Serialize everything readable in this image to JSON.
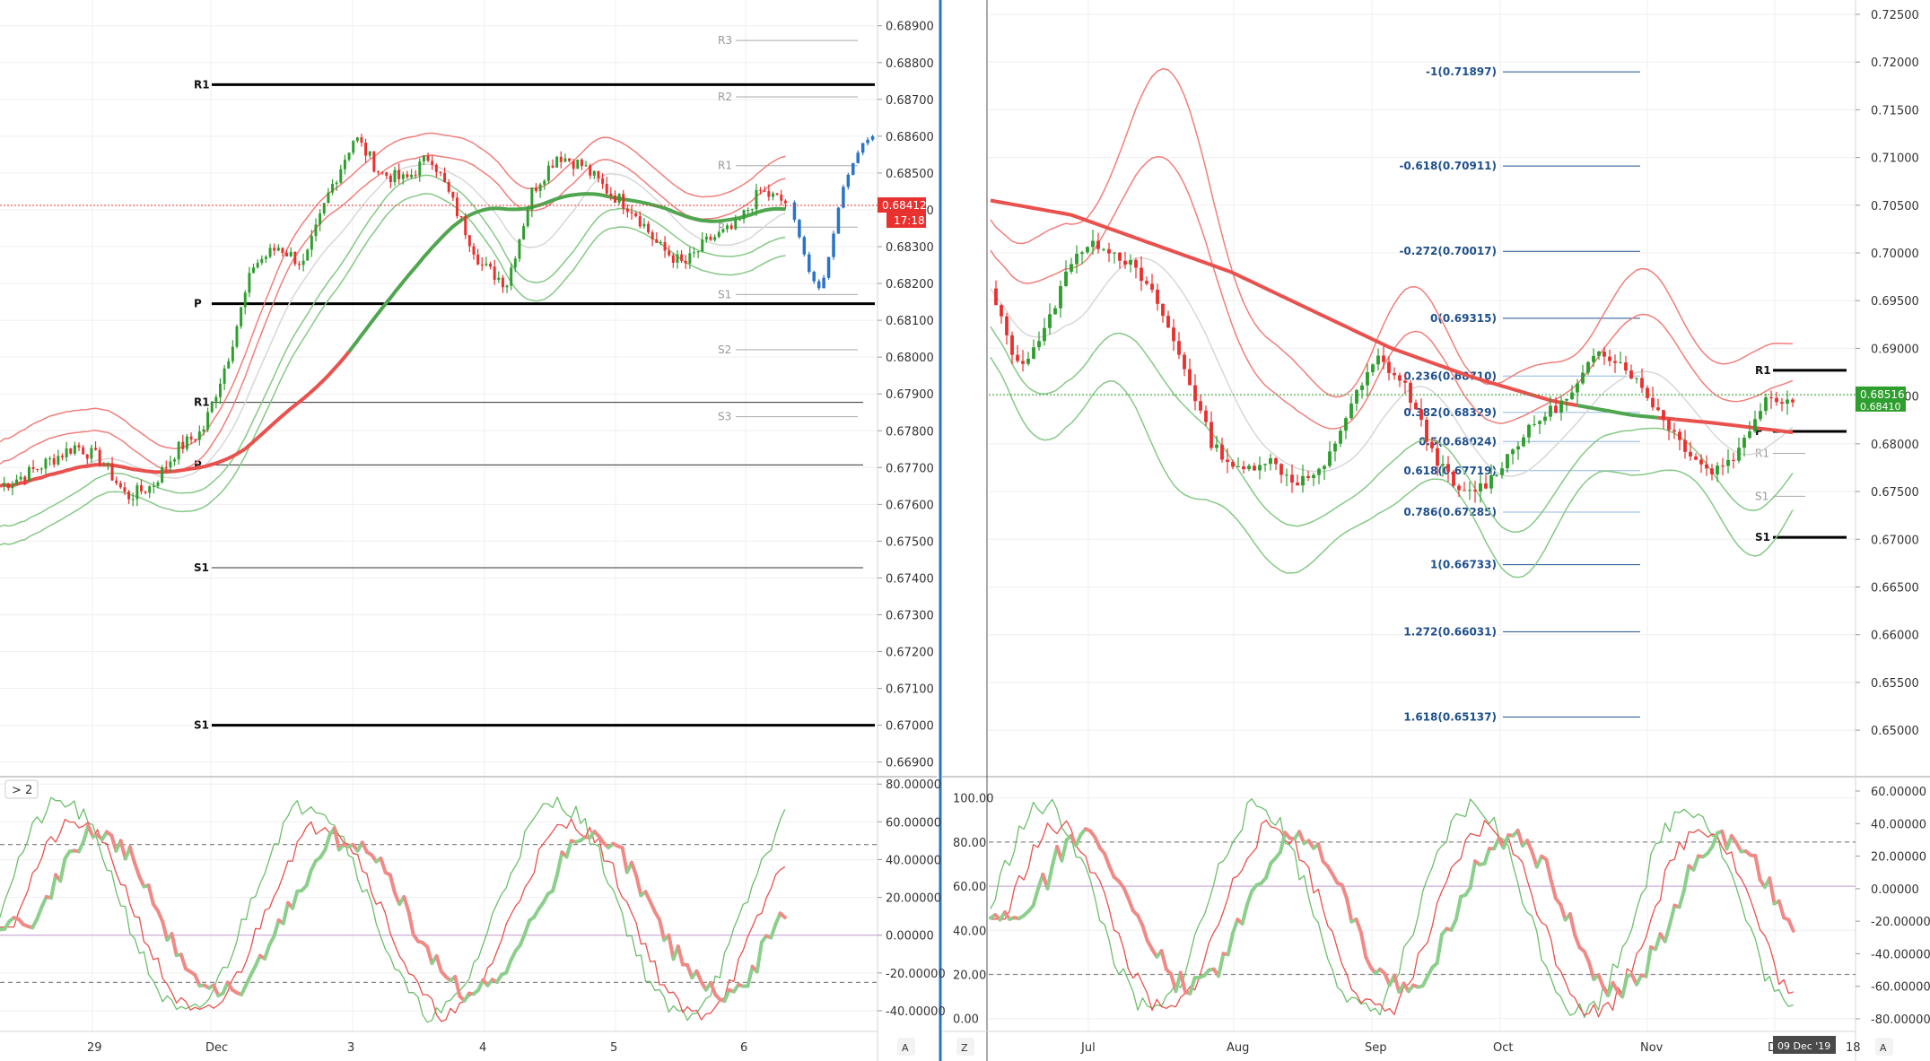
{
  "colors": {
    "bull": "#2e9e2e",
    "bear": "#e8312f",
    "forecast": "#2a73c9",
    "band_red": "#f07f7b",
    "band_green": "#86c986",
    "ma_red": "#e8514d",
    "ma_green": "#4fa64f",
    "grid": "#efefef",
    "divider": "#2a73c9",
    "price_tag": "#e8312f",
    "price_tag2": "#2e9e2e",
    "fib_line": "#1e4f8c"
  },
  "toolbar": {
    "collapse_label": "> 2"
  },
  "corner_buttons": {
    "auto_label": "A",
    "zoom_label": "Z",
    "auto_label_right": "A"
  },
  "chart_data": [
    {
      "id": "left-price",
      "type": "candlestick",
      "y_ticks": [
        "0.68900",
        "0.68800",
        "0.68700",
        "0.68600",
        "0.68500",
        "0.68400",
        "0.68300",
        "0.68200",
        "0.68100",
        "0.68000",
        "0.67900",
        "0.67800",
        "0.67700",
        "0.67600",
        "0.67500",
        "0.67400",
        "0.67300",
        "0.67200",
        "0.67100",
        "0.67000",
        "0.66900"
      ],
      "ylim": [
        0.6687,
        0.6897
      ],
      "x_ticks": [
        "29",
        "Dec",
        "3",
        "4",
        "5",
        "6"
      ],
      "current_price": {
        "value": 0.68412,
        "label": "0.68412",
        "countdown": "17:18"
      },
      "pivot_levels": [
        {
          "label": "R1",
          "value": 0.6874,
          "style": "bold"
        },
        {
          "label": "P",
          "value": 0.68145,
          "style": "bold"
        },
        {
          "label": "S1",
          "value": 0.67,
          "style": "bold"
        },
        {
          "label": "R1",
          "value": 0.67877,
          "style": "thin"
        },
        {
          "label": "P",
          "value": 0.67707,
          "style": "thin"
        },
        {
          "label": "S1",
          "value": 0.67428,
          "style": "thin"
        },
        {
          "label": "R3",
          "value": 0.6886,
          "style": "grey"
        },
        {
          "label": "R2",
          "value": 0.68707,
          "style": "grey"
        },
        {
          "label": "R1",
          "value": 0.6852,
          "style": "grey"
        },
        {
          "label": "P",
          "value": 0.68353,
          "style": "grey"
        },
        {
          "label": "S1",
          "value": 0.6817,
          "style": "grey"
        },
        {
          "label": "S2",
          "value": 0.6802,
          "style": "grey"
        },
        {
          "label": "S3",
          "value": 0.67838,
          "style": "grey"
        }
      ]
    },
    {
      "id": "right-price",
      "type": "candlestick",
      "y_ticks": [
        "0.72500",
        "0.72000",
        "0.71500",
        "0.71000",
        "0.70500",
        "0.70000",
        "0.69500",
        "0.69000",
        "0.68500",
        "0.68000",
        "0.67500",
        "0.67000",
        "0.66500",
        "0.66000",
        "0.65500",
        "0.65000"
      ],
      "ylim": [
        0.6455,
        0.7265
      ],
      "x_ticks": [
        "Jul",
        "Aug",
        "Sep",
        "Oct",
        "Nov",
        "D",
        "18"
      ],
      "current_price": {
        "value": 0.68516,
        "label": "0.68516",
        "sub_label": "0.68410"
      },
      "date_badge": "09 Dec '19",
      "fib_levels": [
        {
          "label": "-1(0.71897)",
          "value": 0.71897
        },
        {
          "label": "-0.618(0.70911)",
          "value": 0.70911
        },
        {
          "label": "-0.272(0.70017)",
          "value": 0.70017
        },
        {
          "label": "0(0.69315)",
          "value": 0.69315
        },
        {
          "label": "0.236(0.68710)",
          "value": 0.6871
        },
        {
          "label": "0.382(0.68329)",
          "value": 0.68329
        },
        {
          "label": "0.5(0.68024)",
          "value": 0.68024
        },
        {
          "label": "0.618(0.67719)",
          "value": 0.67719
        },
        {
          "label": "0.786(0.67285)",
          "value": 0.67285
        },
        {
          "label": "1(0.66733)",
          "value": 0.66733
        },
        {
          "label": "1.272(0.66031)",
          "value": 0.66031
        },
        {
          "label": "1.618(0.65137)",
          "value": 0.65137
        }
      ],
      "pivot_levels": [
        {
          "label": "R1",
          "value": 0.6877,
          "style": "bold"
        },
        {
          "label": "P",
          "value": 0.6813,
          "style": "bold"
        },
        {
          "label": "S1",
          "value": 0.6702,
          "style": "bold"
        },
        {
          "label": "R1",
          "value": 0.679,
          "style": "grey"
        },
        {
          "label": "S1",
          "value": 0.6745,
          "style": "grey"
        }
      ]
    },
    {
      "id": "left-osc",
      "type": "line",
      "y_ticks": [
        "80.00000",
        "60.00000",
        "40.00000",
        "20.00000",
        "0.00000",
        "-20.00000",
        "-40.00000"
      ],
      "ylim": [
        -50,
        82
      ],
      "upper_level": 48,
      "lower_level": -25,
      "mid_level": 0
    },
    {
      "id": "right-osc",
      "type": "line",
      "y_ticks_left": [
        "100.00",
        "80.00",
        "60.00",
        "40.00",
        "20.00",
        "0.00"
      ],
      "y_ticks_right": [
        "60.00000",
        "40.00000",
        "20.00000",
        "0.00000",
        "-20.00000",
        "-40.00000",
        "-60.00000",
        "-80.00000"
      ],
      "ylim": [
        -5,
        108
      ],
      "upper_level": 80,
      "lower_level": 20,
      "mid_level": 60
    }
  ]
}
